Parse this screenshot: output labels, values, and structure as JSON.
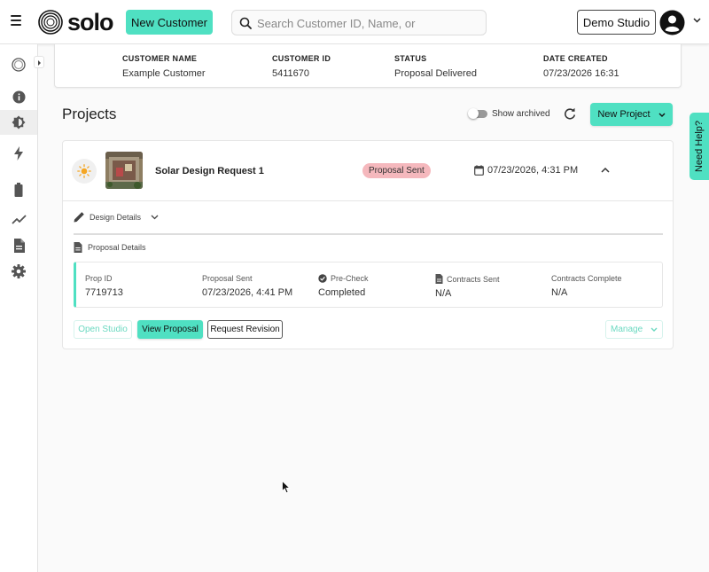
{
  "header": {
    "logo_text": "solo",
    "new_customer_label": "New Customer",
    "search_placeholder": "Search Customer ID, Name, or",
    "studio_label": "Demo Studio"
  },
  "sidebar": {
    "items": [
      {
        "icon": "logo-circle-icon"
      },
      {
        "icon": "info-icon"
      },
      {
        "icon": "brightness-icon",
        "active": true
      },
      {
        "icon": "lightning-icon"
      },
      {
        "icon": "battery-icon"
      },
      {
        "icon": "trending-icon"
      },
      {
        "icon": "document-icon"
      },
      {
        "icon": "gear-icon"
      }
    ]
  },
  "customer": {
    "name_label": "CUSTOMER NAME",
    "name_value": "Example Customer",
    "id_label": "CUSTOMER ID",
    "id_value": "5411670",
    "status_label": "STATUS",
    "status_value": "Proposal Delivered",
    "date_label": "DATE CREATED",
    "date_value": "07/23/2026 16:31"
  },
  "projects": {
    "title": "Projects",
    "show_archived_label": "Show archived",
    "new_project_label": "New Project",
    "items": [
      {
        "name": "Solar Design Request 1",
        "status_badge": "Proposal Sent",
        "date": "07/23/2026, 4:31 PM",
        "design_details_label": "Design Details",
        "proposal_details_label": "Proposal Details",
        "proposal": {
          "prop_id_label": "Prop ID",
          "prop_id_value": "7719713",
          "sent_label": "Proposal Sent",
          "sent_value": "07/23/2026, 4:41 PM",
          "precheck_label": "Pre-Check",
          "precheck_value": "Completed",
          "contracts_sent_label": "Contracts Sent",
          "contracts_sent_value": "N/A",
          "contracts_complete_label": "Contracts Complete",
          "contracts_complete_value": "N/A"
        },
        "actions": {
          "open_studio": "Open Studio",
          "view_proposal": "View Proposal",
          "request_revision": "Request Revision",
          "manage": "Manage"
        }
      }
    ]
  },
  "help": {
    "label": "Need Help?"
  },
  "colors": {
    "accent": "#4fe0c2",
    "badge": "#f5b8bd"
  }
}
